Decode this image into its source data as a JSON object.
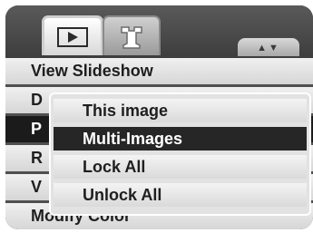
{
  "tabs": [
    {
      "icon": "play-icon",
      "active": true
    },
    {
      "icon": "wrench-icon",
      "active": false
    }
  ],
  "scroll_indicator": "▲▼",
  "menu": {
    "items": [
      {
        "label": "View Slideshow"
      },
      {
        "label": "D"
      },
      {
        "label": "P",
        "selected": true
      },
      {
        "label": "R"
      },
      {
        "label": "V"
      },
      {
        "label": "Modify Color"
      }
    ]
  },
  "popup": {
    "options": [
      {
        "label": "This image"
      },
      {
        "label": "Multi-Images",
        "selected": true
      },
      {
        "label": "Lock All"
      },
      {
        "label": "Unlock All"
      }
    ]
  }
}
